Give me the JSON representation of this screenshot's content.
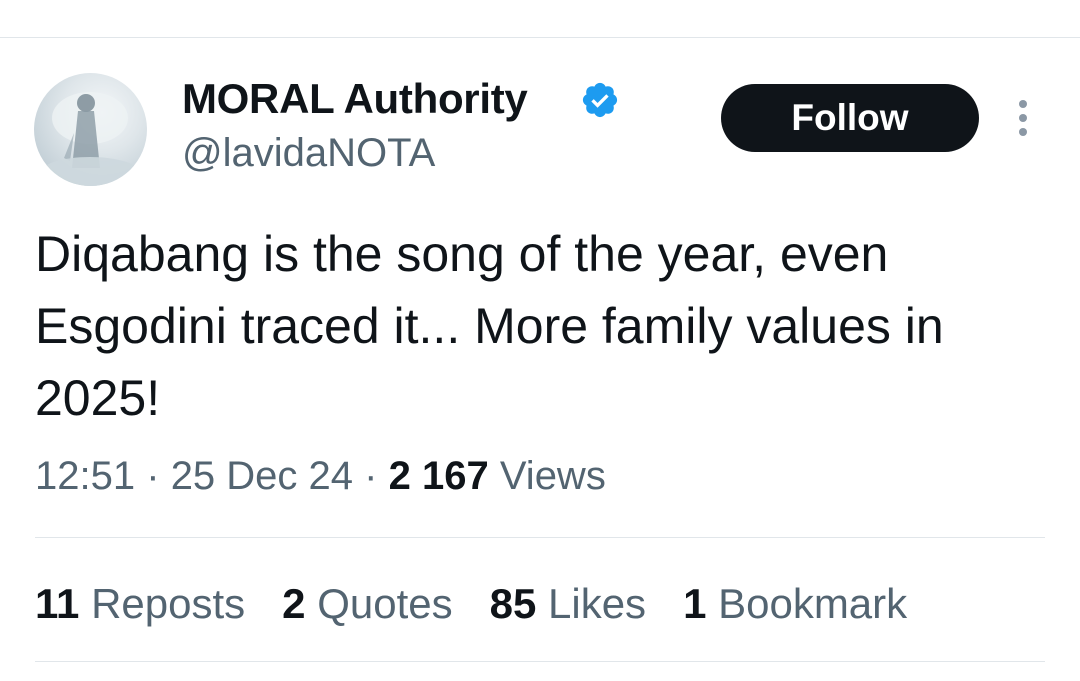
{
  "author": {
    "display_name": "MORAL Authority",
    "handle": "@lavidaNOTA",
    "verified": true,
    "verified_color": "#1d9bf0"
  },
  "actions": {
    "follow_label": "Follow",
    "more_icon": "more-vertical-icon"
  },
  "tweet": {
    "text": "Diqabang is the song of the year, even Esgodini traced it... More family values in 2025!"
  },
  "meta": {
    "time": "12:51",
    "separator": "·",
    "date": "25 Dec 24",
    "views_count": "2 167",
    "views_label": "Views"
  },
  "stats": [
    {
      "count": "11",
      "label": "Reposts"
    },
    {
      "count": "2",
      "label": "Quotes"
    },
    {
      "count": "85",
      "label": "Likes"
    },
    {
      "count": "1",
      "label": "Bookmark"
    }
  ],
  "colors": {
    "text_primary": "#0f1419",
    "text_secondary": "#536471",
    "divider": "#e1e6ea",
    "button_bg": "#0f1419"
  }
}
